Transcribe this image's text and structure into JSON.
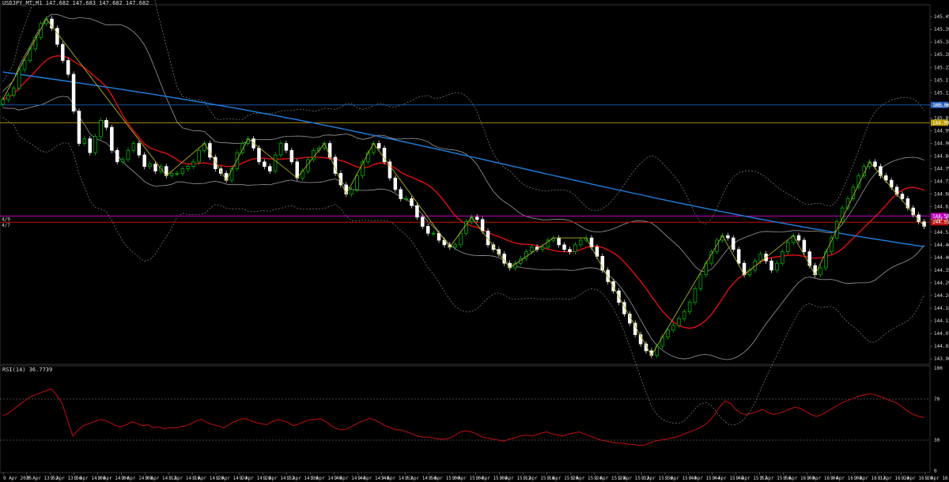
{
  "header": {
    "symbol_line": "USDJPY_MT,M1  147.682 147.683 147.682 147.682",
    "rsi_label": "RSI(14) 36.7739"
  },
  "colors": {
    "bg": "#000000",
    "bull": "#00c800",
    "bear": "#ffffff",
    "ma_red": "#e01010",
    "ma_blue": "#2080e0",
    "bands": "#c0c0c0",
    "zigzag": "#b0b020",
    "hline_blue": "#2060c0",
    "hline_yellow": "#c0a000",
    "hline_magenta": "#c000c0",
    "hline_red": "#c01010",
    "rsi": "#c01010"
  },
  "chart_data": {
    "type": "candlestick",
    "y_axis_ticks": [
      "145.450",
      "145.395",
      "145.340",
      "145.285",
      "145.230",
      "145.175",
      "145.120",
      "145.065",
      "145.010",
      "144.955",
      "144.900",
      "144.845",
      "144.790",
      "144.735",
      "144.680",
      "144.625",
      "144.570",
      "144.515",
      "144.460",
      "144.405",
      "144.350",
      "144.295",
      "144.240",
      "144.185",
      "144.130",
      "144.075",
      "144.020",
      "143.965"
    ],
    "ylim": [
      143.945,
      145.495
    ],
    "x_axis_ticks": [
      "9 Apr 2025",
      "9 Apr 13:52",
      "9 Apr 13:56",
      "9 Apr 14:00",
      "9 Apr 14:04",
      "9 Apr 14:08",
      "9 Apr 14:12",
      "9 Apr 14:16",
      "9 Apr 14:20",
      "9 Apr 14:24",
      "9 Apr 14:28",
      "9 Apr 14:32",
      "9 Apr 14:36",
      "9 Apr 14:40",
      "9 Apr 14:44",
      "9 Apr 14:48",
      "9 Apr 14:52",
      "9 Apr 14:56",
      "9 Apr 15:00",
      "9 Apr 15:04",
      "9 Apr 15:08",
      "9 Apr 15:12",
      "9 Apr 15:16",
      "9 Apr 15:20",
      "9 Apr 15:24",
      "9 Apr 15:28",
      "9 Apr 15:32",
      "9 Apr 15:36",
      "9 Apr 15:40",
      "9 Apr 15:44",
      "9 Apr 15:48",
      "9 Apr 15:52",
      "9 Apr 15:56",
      "9 Apr 16:00",
      "9 Apr 16:04",
      "9 Apr 16:08",
      "9 Apr 16:12",
      "9 Apr 16:16",
      "9 Apr 16:20",
      "9 Apr 16:24"
    ],
    "hlines": [
      {
        "price": 145.067,
        "label": "145.067",
        "color": "blue"
      },
      {
        "price": 144.99,
        "label": "144.990",
        "color": "yellow"
      },
      {
        "price": 144.585,
        "label": "144.585",
        "color": "magenta"
      },
      {
        "price": 144.558,
        "label": "144.558",
        "color": "red"
      }
    ],
    "hline_left_labels": [
      "4/9",
      "4/7"
    ],
    "close": [
      145.09,
      145.11,
      145.14,
      145.22,
      145.26,
      145.31,
      145.36,
      145.42,
      145.44,
      145.4,
      145.33,
      145.26,
      145.2,
      145.04,
      144.9,
      144.92,
      144.86,
      144.93,
      145.0,
      144.97,
      144.87,
      144.82,
      144.83,
      144.87,
      144.9,
      144.85,
      144.8,
      144.81,
      144.78,
      144.8,
      144.76,
      144.77,
      144.77,
      144.79,
      144.8,
      144.82,
      144.87,
      144.9,
      144.84,
      144.79,
      144.77,
      144.74,
      144.79,
      144.86,
      144.9,
      144.92,
      144.88,
      144.82,
      144.8,
      144.78,
      144.85,
      144.9,
      144.87,
      144.82,
      144.75,
      144.78,
      144.83,
      144.87,
      144.88,
      144.9,
      144.84,
      144.77,
      144.72,
      144.68,
      144.7,
      144.76,
      144.82,
      144.86,
      144.9,
      144.88,
      144.82,
      144.75,
      144.7,
      144.66,
      144.66,
      144.63,
      144.58,
      144.54,
      144.51,
      144.51,
      144.48,
      144.46,
      144.45,
      144.46,
      144.51,
      144.56,
      144.58,
      144.57,
      144.52,
      144.46,
      144.44,
      144.42,
      144.38,
      144.36,
      144.38,
      144.4,
      144.43,
      144.45,
      144.44,
      144.45,
      144.48,
      144.49,
      144.46,
      144.44,
      144.43,
      144.46,
      144.48,
      144.49,
      144.45,
      144.41,
      144.35,
      144.3,
      144.26,
      144.21,
      144.16,
      144.12,
      144.07,
      144.03,
      144.0,
      143.98,
      144.02,
      144.06,
      144.09,
      144.11,
      144.14,
      144.17,
      144.21,
      144.27,
      144.33,
      144.38,
      144.43,
      144.48,
      144.5,
      144.49,
      144.44,
      144.38,
      144.33,
      144.35,
      144.39,
      144.42,
      144.39,
      144.35,
      144.38,
      144.43,
      144.47,
      144.5,
      144.48,
      144.43,
      144.37,
      144.33,
      144.36,
      144.43,
      144.49,
      144.56,
      144.62,
      144.66,
      144.71,
      144.76,
      144.8,
      144.82,
      144.8,
      144.76,
      144.74,
      144.71,
      144.68,
      144.66,
      144.62,
      144.59,
      144.56,
      144.54
    ],
    "rsi": {
      "ylim": [
        0,
        100
      ],
      "ticks": [
        "100",
        "70",
        "30",
        "0"
      ],
      "levels": [
        70,
        30
      ],
      "values": [
        54,
        56,
        60,
        64,
        68,
        72,
        74,
        76,
        78,
        80,
        74,
        66,
        50,
        34,
        40,
        44,
        46,
        48,
        50,
        49,
        47,
        44,
        43,
        45,
        48,
        46,
        44,
        45,
        42,
        43,
        41,
        42,
        42,
        43,
        44,
        46,
        49,
        50,
        47,
        45,
        44,
        42,
        45,
        48,
        50,
        51,
        49,
        47,
        46,
        45,
        48,
        50,
        49,
        47,
        44,
        46,
        48,
        50,
        50,
        51,
        48,
        44,
        41,
        40,
        41,
        44,
        47,
        49,
        51,
        50,
        47,
        44,
        42,
        40,
        40,
        38,
        36,
        34,
        33,
        33,
        32,
        31,
        31,
        32,
        35,
        38,
        39,
        38,
        36,
        33,
        32,
        31,
        30,
        29,
        31,
        32,
        34,
        35,
        34,
        35,
        37,
        38,
        36,
        35,
        34,
        36,
        37,
        38,
        36,
        34,
        32,
        30,
        29,
        28,
        27,
        27,
        26,
        26,
        25,
        25,
        27,
        29,
        30,
        31,
        32,
        33,
        35,
        37,
        39,
        41,
        44,
        48,
        54,
        62,
        68,
        66,
        60,
        56,
        55,
        56,
        58,
        60,
        57,
        55,
        56,
        58,
        60,
        62,
        61,
        58,
        55,
        53,
        55,
        58,
        61,
        64,
        67,
        69,
        71,
        73,
        74,
        75,
        74,
        72,
        70,
        68,
        66,
        62,
        58,
        55,
        53,
        52
      ]
    }
  }
}
